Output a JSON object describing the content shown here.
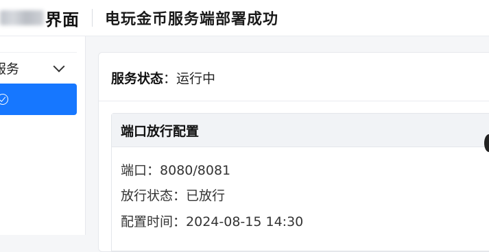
{
  "header": {
    "brand_suffix": "界面",
    "title": "电玩金币服务端部署成功"
  },
  "sidebar": {
    "group_label": "服务",
    "active_item_icon": "check-circle-icon"
  },
  "status": {
    "label": "服务状态",
    "separator": "：",
    "value": "运行中"
  },
  "config": {
    "title": "端口放行配置",
    "port_label": "端口",
    "port_value": "8080/8081",
    "state_label": "放行状态",
    "state_value": "已放行",
    "time_label": "配置时间",
    "time_value": "2024-08-15 14:30",
    "separator": "："
  },
  "colors": {
    "accent": "#1677ff",
    "background": "#f5f6f8",
    "panel_header": "#f1f3f6"
  }
}
